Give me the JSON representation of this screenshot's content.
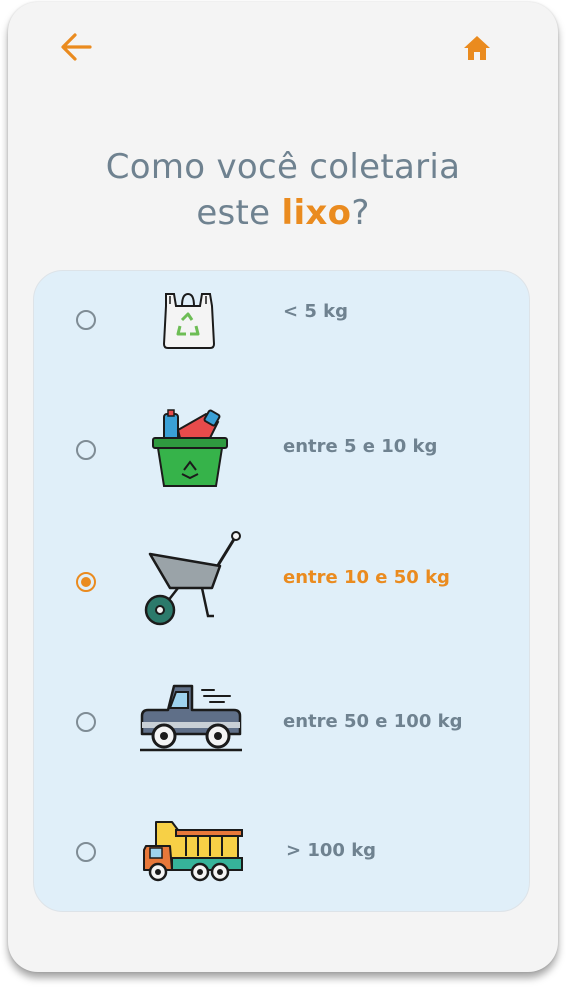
{
  "header": {
    "back_icon": "arrow-left-icon",
    "home_icon": "home-icon",
    "accent_color": "#ea8b1f"
  },
  "question": {
    "line1": "Como você coletaria",
    "line2_prefix": "este ",
    "line2_highlight": "lixo",
    "line2_suffix": "?"
  },
  "options": [
    {
      "label": "< 5 kg",
      "icon": "plastic-bag-icon",
      "selected": false
    },
    {
      "label": "entre 5 e 10 kg",
      "icon": "recycling-basket-icon",
      "selected": false
    },
    {
      "label": "entre 10 e 50 kg",
      "icon": "wheelbarrow-icon",
      "selected": true
    },
    {
      "label": "entre 50 e 100 kg",
      "icon": "pickup-truck-icon",
      "selected": false
    },
    {
      "label": "> 100 kg",
      "icon": "dump-truck-icon",
      "selected": false
    }
  ]
}
